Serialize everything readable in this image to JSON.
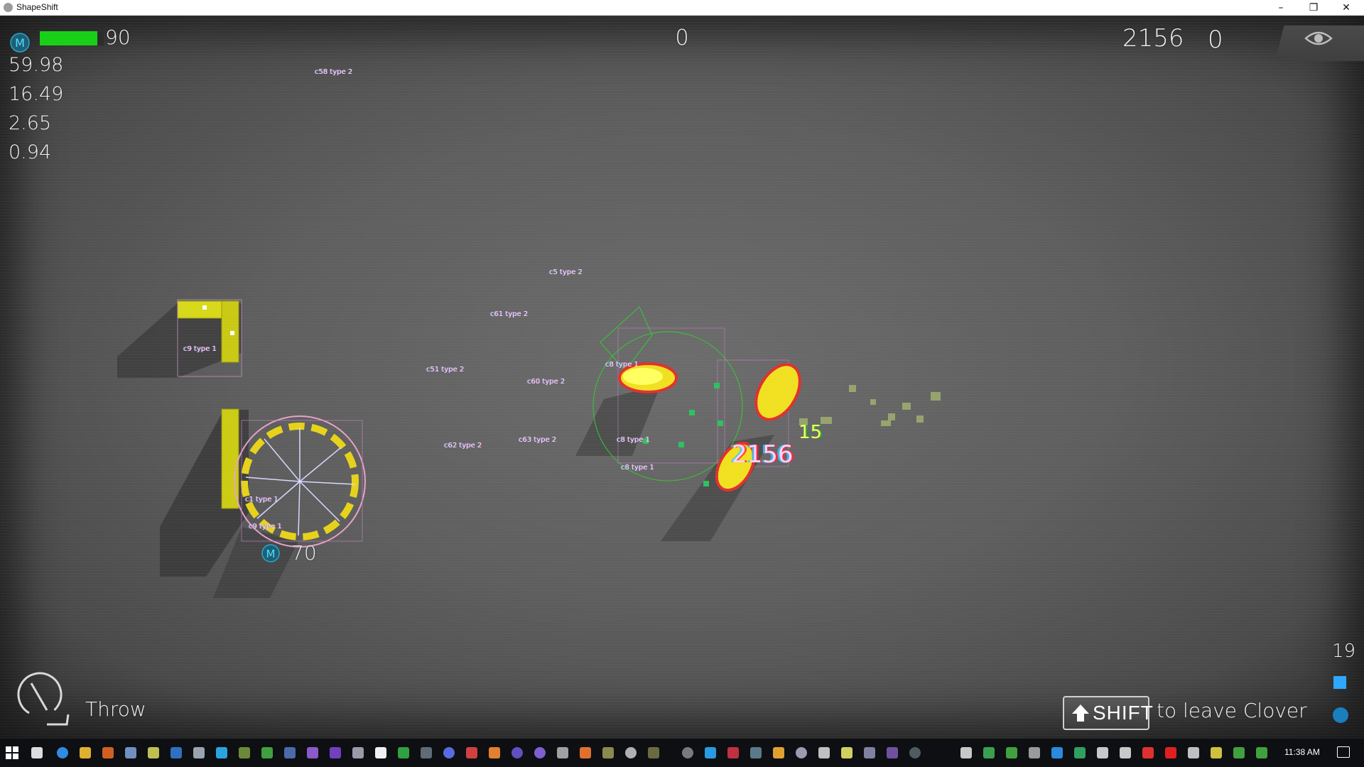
{
  "window": {
    "title": "ShapeShift",
    "controls": {
      "minimize": "–",
      "restore": "❐",
      "close": "✕"
    }
  },
  "hud": {
    "player_icon": "M",
    "health": {
      "value": "90",
      "fraction": 0.9,
      "color": "#19d019"
    },
    "stats": [
      "59.98",
      "16.49",
      "2.65",
      "0.94"
    ],
    "top_center_score": "0",
    "top_right_score": "2156",
    "top_right_zero": "0",
    "eye_icon": "eye-icon"
  },
  "world": {
    "labels": [
      "c58 type 2",
      "c5 type 2",
      "c61 type 2",
      "c51 type 2",
      "c60 type 2",
      "c62 type 2",
      "c63 type 2",
      "c8 type 1",
      "c8 type 1",
      "c8 type 1",
      "c9 type 1",
      "c1 type 1",
      "c9 type 1"
    ],
    "enemy": {
      "icon": "M",
      "health": "70"
    },
    "damage_number": "2156",
    "damage_small": "15"
  },
  "ability": {
    "icon": "throw-icon",
    "label": "Throw"
  },
  "prompt": {
    "key": "SHIFT",
    "text": "to leave Clover"
  },
  "ammo": {
    "count": "19",
    "color": "#2ea8ff"
  },
  "taskbar": {
    "clock": "11:38 AM"
  }
}
